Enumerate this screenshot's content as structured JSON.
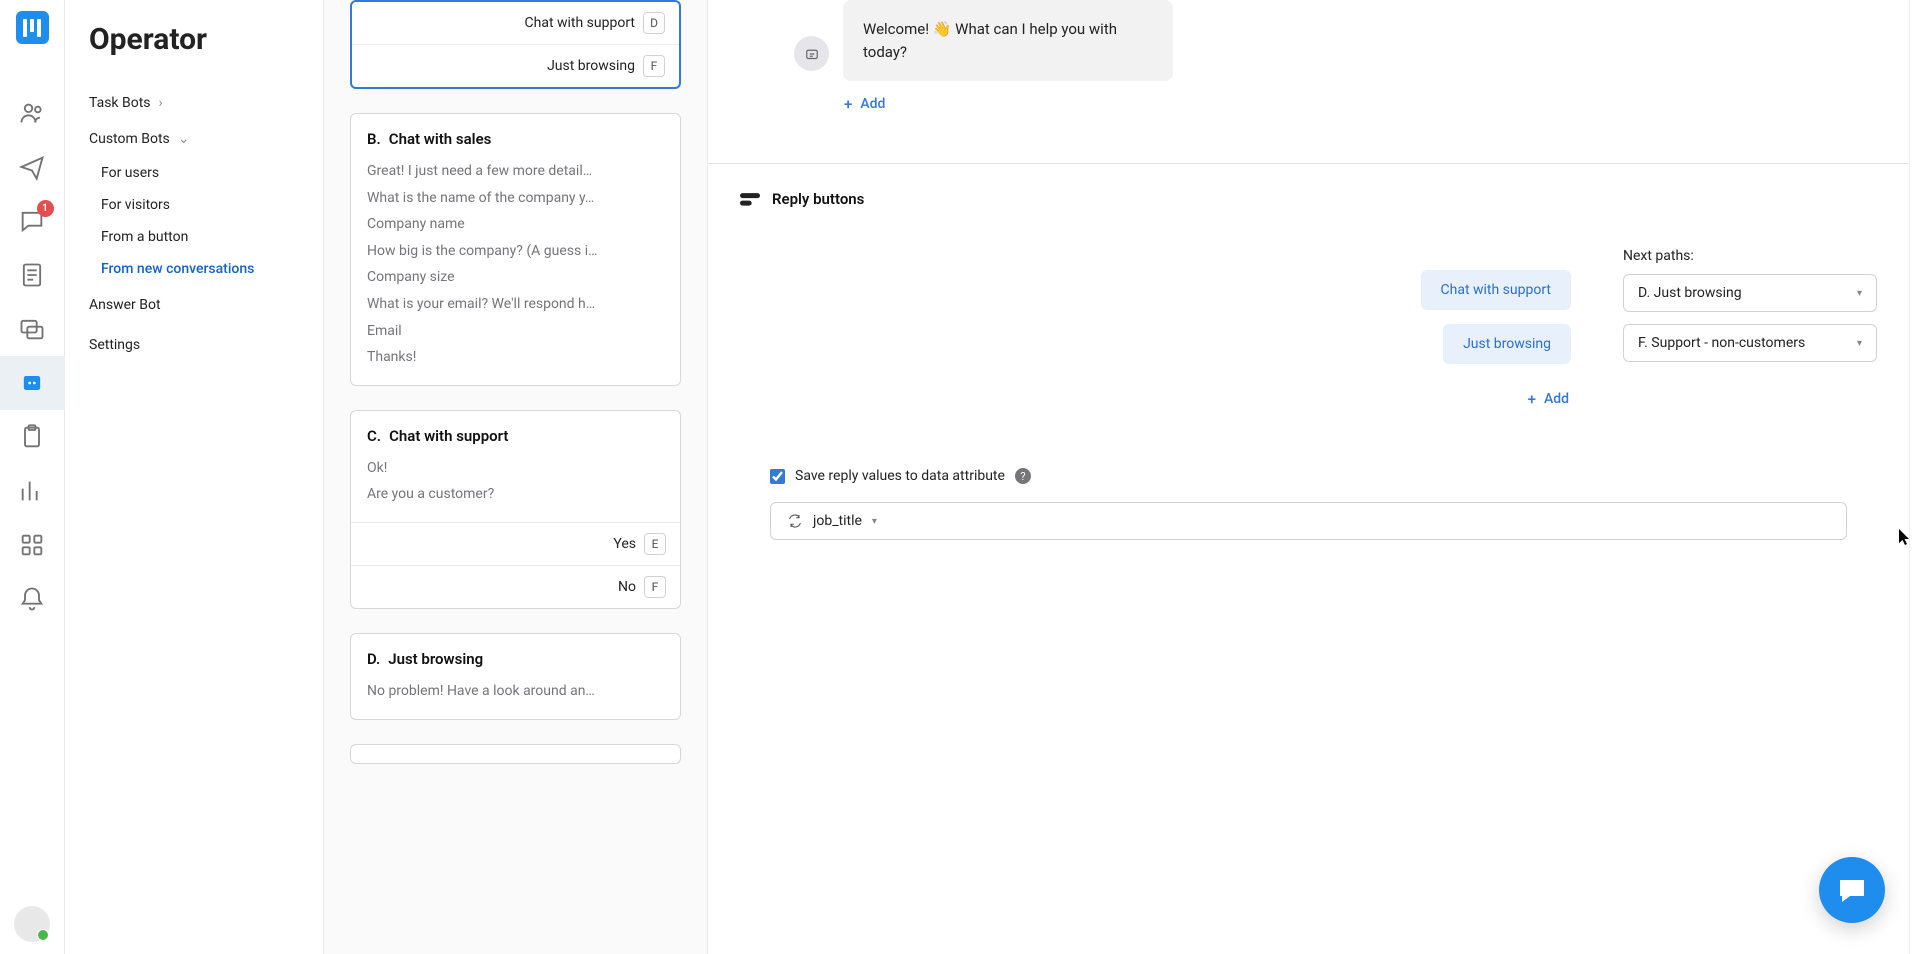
{
  "sidebar": {
    "title": "Operator",
    "task_bots": "Task Bots",
    "custom_bots": "Custom Bots",
    "subs": [
      "For users",
      "For visitors",
      "From a button",
      "From new conversations"
    ],
    "answer_bot": "Answer Bot",
    "settings": "Settings"
  },
  "rail_badge": "1",
  "card_active": {
    "rows": [
      {
        "label": "Chat with support",
        "tag": "D"
      },
      {
        "label": "Just browsing",
        "tag": "F"
      }
    ]
  },
  "card_b": {
    "letter": "B.",
    "title": "Chat with sales",
    "lines": [
      "Great! I just need a few more detail…",
      "What is the name of the company y…",
      "Company name",
      "How big is the company? (A guess i…",
      "Company size",
      "What is your email? We'll respond h…",
      "Email",
      "Thanks!"
    ]
  },
  "card_c": {
    "letter": "C.",
    "title": "Chat with support",
    "lines": [
      "Ok!",
      "Are you a customer?"
    ],
    "rows": [
      {
        "label": "Yes",
        "tag": "E"
      },
      {
        "label": "No",
        "tag": "F"
      }
    ]
  },
  "card_d": {
    "letter": "D.",
    "title": "Just browsing",
    "lines": [
      "No problem! Have a look around an…"
    ]
  },
  "msg": "Welcome! 👋   What can I help you with today?",
  "add": "Add",
  "reply_header": "Reply buttons",
  "reply_chips": [
    "Chat with support",
    "Just browsing"
  ],
  "next_paths_label": "Next paths:",
  "next_paths": [
    "D. Just browsing",
    "F. Support - non-customers"
  ],
  "save_label": "Save reply values to data attribute",
  "attr": "job_title"
}
